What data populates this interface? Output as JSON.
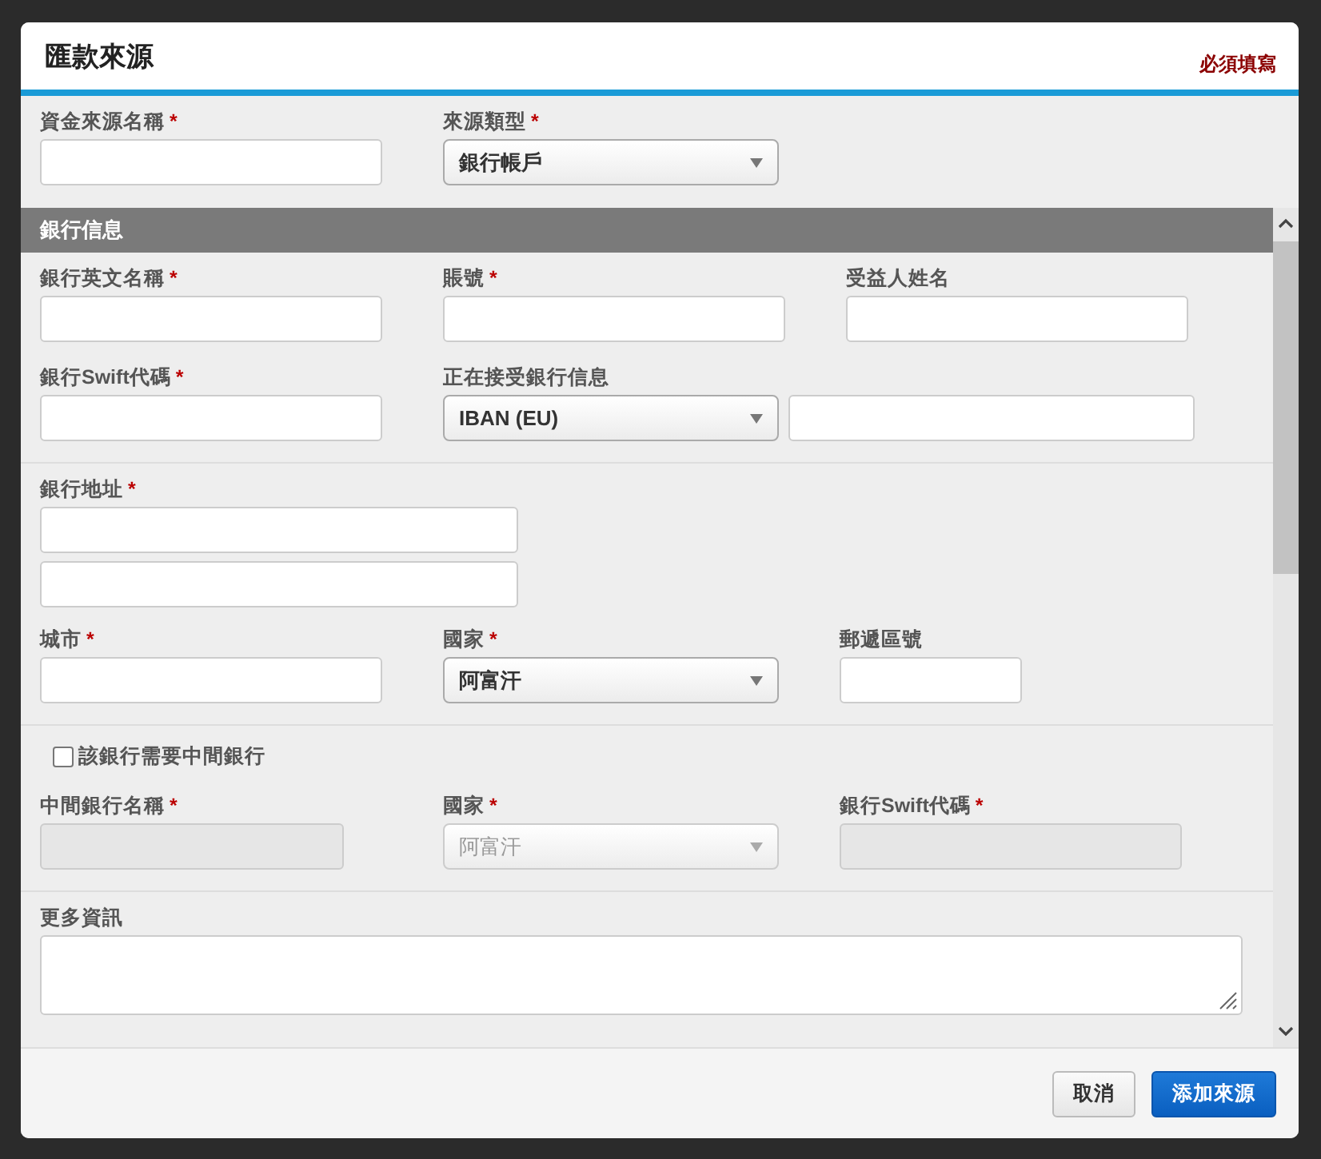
{
  "dialog": {
    "title": "匯款來源",
    "required_note": "必須填寫"
  },
  "source_fields": [
    {
      "label": "資金來源名稱",
      "mark": "*",
      "kind": "input"
    },
    {
      "label": "來源類型",
      "mark": "*",
      "kind": "select",
      "value": "銀行帳戶"
    }
  ],
  "bank_section": {
    "title": "銀行信息"
  },
  "bank_fields": [
    {
      "label": "銀行英文名稱",
      "mark": "*",
      "kind": "input"
    },
    {
      "label": "賬號",
      "mark": "*",
      "kind": "input"
    },
    {
      "label": "受益人姓名",
      "kind": "input"
    },
    {
      "label": "銀行Swift代碼",
      "mark": "*",
      "kind": "input"
    },
    {
      "label": "正在接受銀行信息",
      "kind": "select",
      "value": "IBAN (EU)"
    }
  ],
  "address": {
    "label": "銀行地址",
    "mark": "*"
  },
  "location_fields": [
    {
      "label": "城市",
      "mark": "*",
      "kind": "input"
    },
    {
      "label": "國家",
      "mark": "*",
      "kind": "select",
      "value": "阿富汗"
    },
    {
      "label": "郵遞區號",
      "kind": "input"
    }
  ],
  "intermediary": {
    "label": "該銀行需要中間銀行",
    "checked": false
  },
  "intermediary_fields": [
    {
      "label": "中間銀行名稱",
      "mark": "*",
      "kind": "input",
      "disabled": true
    },
    {
      "label": "國家",
      "mark": "*",
      "kind": "select",
      "value": "阿富汗",
      "disabled": true
    },
    {
      "label": "銀行Swift代碼",
      "mark": "*",
      "kind": "input",
      "disabled": true
    }
  ],
  "more_info": {
    "label": "更多資訊"
  },
  "buttons": [
    {
      "label": "取消",
      "kind": "secondary"
    },
    {
      "label": "添加來源",
      "kind": "primary"
    }
  ]
}
